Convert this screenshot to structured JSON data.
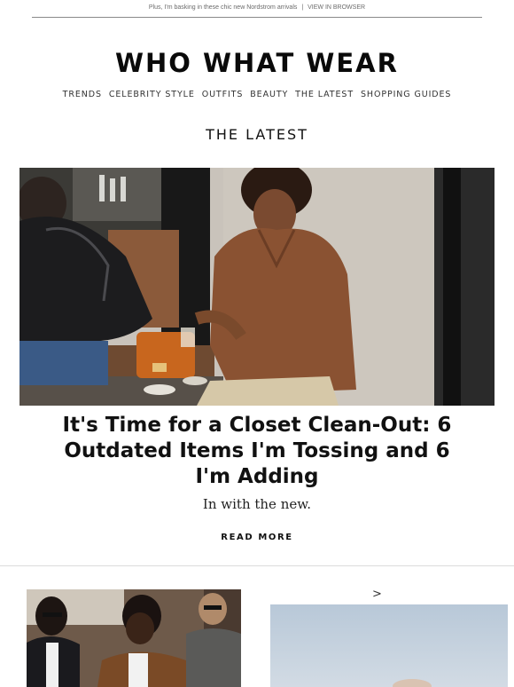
{
  "preheader": {
    "text": "Plus, I'm basking in these chic new Nordstrom arrivals",
    "separator": "|",
    "view_in_browser": "VIEW IN BROWSER"
  },
  "brand": {
    "logo_text": "WHO WHAT WEAR"
  },
  "nav": {
    "items": [
      "TRENDS",
      "CELEBRITY STYLE",
      "OUTFITS",
      "BEAUTY",
      "THE LATEST",
      "SHOPPING GUIDES"
    ]
  },
  "section": {
    "title": "THE LATEST"
  },
  "feature": {
    "headline": "It's Time for a Closet Clean-Out: 6 Outdated Items I'm Tossing and 6 I'm Adding",
    "subhead": "In with the new.",
    "cta": "READ MORE"
  },
  "cards": {
    "arrow_glyph": ">"
  },
  "colors": {
    "text": "#111111",
    "leather_jacket": "#8a5232",
    "orange_bag": "#c8661e",
    "stone_wall": "#c9c3bb",
    "sky": "#c6d3df"
  }
}
